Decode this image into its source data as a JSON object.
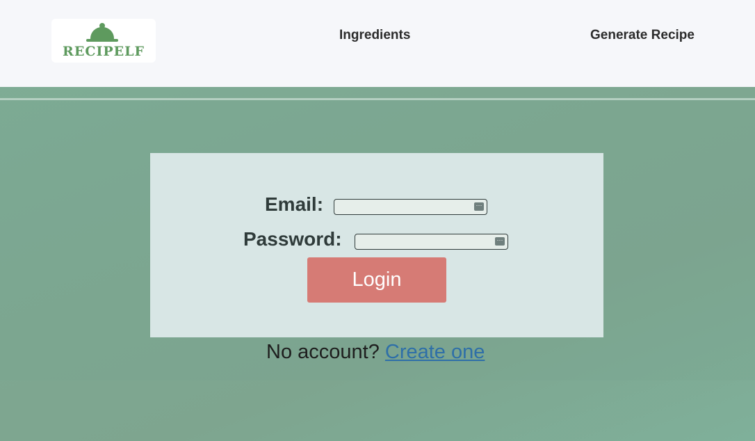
{
  "brand": {
    "logo_text": "RECIPELF",
    "logo_icon": "cloche-icon"
  },
  "nav": {
    "items": [
      {
        "label": "Ingredients"
      },
      {
        "label": "Generate Recipe"
      }
    ]
  },
  "login_form": {
    "email_label": "Email:",
    "email_value": "",
    "password_label": "Password:",
    "password_value": "",
    "autofill_icon": "password-manager-key-icon",
    "submit_label": "Login"
  },
  "signup": {
    "prompt": "No account?",
    "link_text": "Create one"
  },
  "colors": {
    "background": "#7ea892",
    "navbar": "#f6f7fa",
    "card": "#d8e6e5",
    "button": "#d67b75",
    "link": "#2e6fa8",
    "logo_green": "#5e9a5e"
  }
}
